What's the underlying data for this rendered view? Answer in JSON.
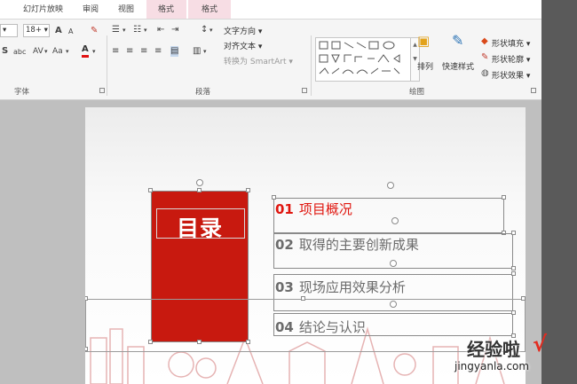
{
  "tabs": [
    "幻灯片放映",
    "审阅",
    "视图",
    "格式",
    "格式"
  ],
  "font": {
    "size_value": "18+",
    "grow": "A",
    "shrink": "A",
    "clear": "清除格式",
    "shadow": "S",
    "strike": "abc",
    "spacing": "AV",
    "case": "Aa",
    "color_letter": "A",
    "group_label": "字体"
  },
  "paragraph": {
    "text_direction": "文字方向",
    "align_text": "对齐文本",
    "convert_smartart": "转换为 SmartArt",
    "group_label": "段落"
  },
  "drawing": {
    "arrange": "排列",
    "quick_styles": "快速样式",
    "shape_fill": "形状填充",
    "shape_outline": "形状轮廓",
    "shape_effects": "形状效果",
    "group_label": "绘图"
  },
  "slide": {
    "title": "目录",
    "items": [
      {
        "num": "01",
        "text": "项目概况"
      },
      {
        "num": "02",
        "text": "取得的主要创新成果"
      },
      {
        "num": "03",
        "text": "现场应用效果分析"
      },
      {
        "num": "04",
        "text": "结论与认识"
      }
    ]
  },
  "watermark": {
    "text": "经验啦",
    "check": "√",
    "url": "jingyanla.com"
  },
  "colors": {
    "accent": "#c8190f",
    "item_red": "#e0160f",
    "item_gray": "#6b6b6b"
  }
}
